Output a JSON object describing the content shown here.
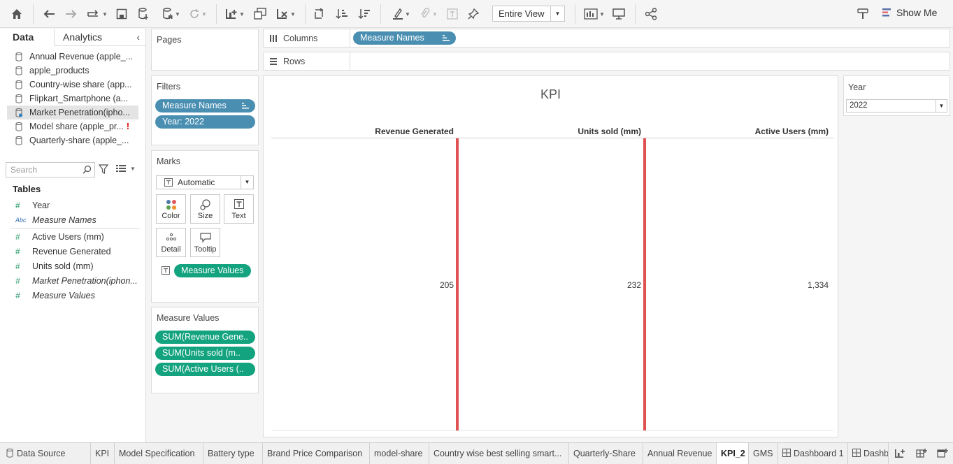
{
  "toolbar": {
    "view_mode": "Entire View",
    "show_me": "Show Me"
  },
  "data_pane": {
    "tab_data": "Data",
    "tab_analytics": "Analytics",
    "datasources": [
      {
        "label": "Annual Revenue (apple_..."
      },
      {
        "label": "apple_products"
      },
      {
        "label": "Country-wise share (app..."
      },
      {
        "label": "Flipkart_Smartphone (a..."
      },
      {
        "label": "Market Penetration(ipho..."
      },
      {
        "label": "Model share (apple_pr..."
      },
      {
        "label": "Quarterly-share (apple_..."
      }
    ],
    "search_placeholder": "Search",
    "tables_heading": "Tables",
    "fields": [
      {
        "type": "#",
        "label": "Year"
      },
      {
        "type": "Abc",
        "label": "Measure Names"
      },
      {
        "type": "#",
        "label": "Active Users (mm)"
      },
      {
        "type": "#",
        "label": "Revenue Generated"
      },
      {
        "type": "#",
        "label": "Units sold (mm)"
      },
      {
        "type": "#",
        "label": "Market Penetration(iphon..."
      },
      {
        "type": "#",
        "label": "Measure Values"
      }
    ]
  },
  "pages": {
    "title": "Pages"
  },
  "filters": {
    "title": "Filters",
    "pills": [
      "Measure Names",
      "Year: 2022"
    ]
  },
  "marks": {
    "title": "Marks",
    "mark_type": "Automatic",
    "buttons": [
      "Color",
      "Size",
      "Text",
      "Detail",
      "Tooltip"
    ],
    "pill": "Measure Values"
  },
  "measure_values": {
    "title": "Measure Values",
    "pills": [
      "SUM(Revenue Gene..",
      "SUM(Units sold (m..",
      "SUM(Active Users (.."
    ]
  },
  "shelves": {
    "columns_label": "Columns",
    "columns_pill": "Measure Names",
    "rows_label": "Rows"
  },
  "viz": {
    "title": "KPI",
    "columns": [
      {
        "header": "Revenue Generated",
        "value": "205"
      },
      {
        "header": "Units sold (mm)",
        "value": "232"
      },
      {
        "header": "Active Users (mm)",
        "value": "1,334"
      }
    ]
  },
  "year_filter": {
    "label": "Year",
    "value": "2022"
  },
  "sheet_tabs": [
    {
      "label": "Data Source"
    },
    {
      "label": "KPI"
    },
    {
      "label": "Model Specification"
    },
    {
      "label": "Battery type"
    },
    {
      "label": "Brand Price Comparison"
    },
    {
      "label": "model-share"
    },
    {
      "label": "Country wise best selling smart..."
    },
    {
      "label": "Quarterly-Share"
    },
    {
      "label": "Annual Revenue"
    },
    {
      "label": "KPI_2"
    },
    {
      "label": "GMS"
    },
    {
      "label": "Dashboard 1"
    },
    {
      "label": "Dashb"
    }
  ]
}
